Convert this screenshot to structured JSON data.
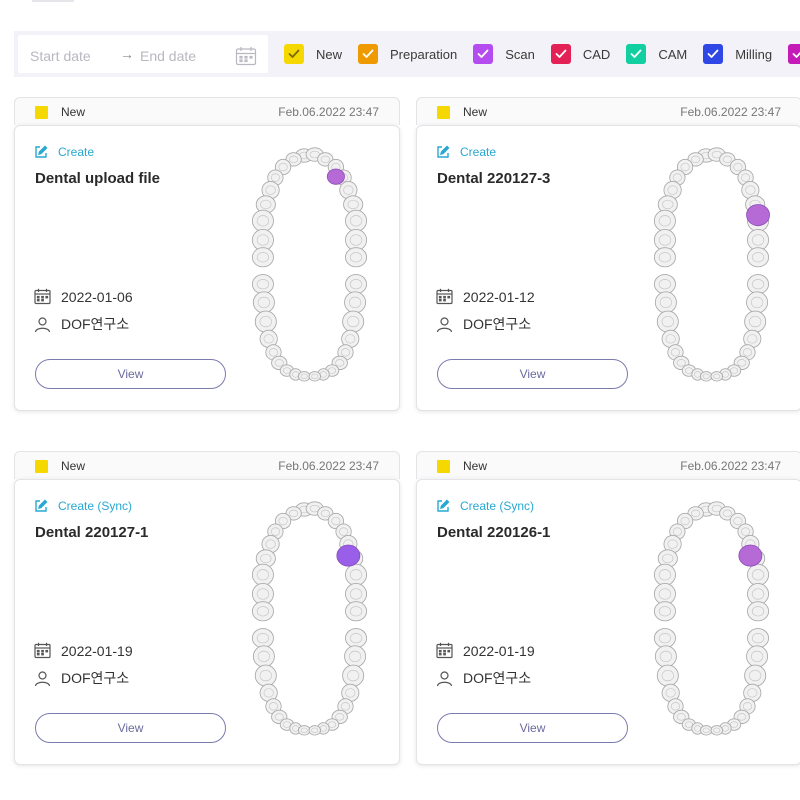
{
  "filter_bar": {
    "start_placeholder": "Start date",
    "arrow": "→",
    "end_placeholder": "End date",
    "filters": [
      {
        "label": "New",
        "color": "#f5d800",
        "icon": "check-icon"
      },
      {
        "label": "Preparation",
        "color": "#ee9a00",
        "icon": "check-icon"
      },
      {
        "label": "Scan",
        "color": "#b44cf0",
        "icon": "check-icon"
      },
      {
        "label": "CAD",
        "color": "#e42155",
        "icon": "check-icon"
      },
      {
        "label": "CAM",
        "color": "#12cfa2",
        "icon": "check-icon"
      },
      {
        "label": "Milling",
        "color": "#2f47e4",
        "icon": "check-icon"
      },
      {
        "label": "",
        "color": "#c31ab8",
        "icon": "check-icon"
      }
    ]
  },
  "cards": [
    {
      "status": "New",
      "status_color": "#f5d800",
      "timestamp": "Feb.06.2022 23:47",
      "create_label": "Create",
      "title": "Dental upload file",
      "date": "2022-01-06",
      "lab": "DOF연구소",
      "view_label": "View",
      "highlight": "upper-right-canine",
      "highlight_color": "#b56ad6"
    },
    {
      "status": "New",
      "status_color": "#f5d800",
      "timestamp": "Feb.06.2022 23:47",
      "create_label": "Create",
      "title": "Dental 220127-3",
      "date": "2022-01-12",
      "lab": "DOF연구소",
      "view_label": "View",
      "highlight": "upper-right-molar",
      "highlight_color": "#b56ad6"
    },
    {
      "status": "New",
      "status_color": "#f5d800",
      "timestamp": "Feb.06.2022 23:47",
      "create_label": "Create (Sync)",
      "title": "Dental 220127-1",
      "date": "2022-01-19",
      "lab": "DOF연구소",
      "view_label": "View",
      "highlight": "upper-right-premolar",
      "highlight_color": "#9a5fe8"
    },
    {
      "status": "New",
      "status_color": "#f5d800",
      "timestamp": "Feb.06.2022 23:47",
      "create_label": "Create (Sync)",
      "title": "Dental 220126-1",
      "date": "2022-01-19",
      "lab": "DOF연구소",
      "view_label": "View",
      "highlight": "upper-right-premolar",
      "highlight_color": "#b56ad6"
    }
  ]
}
